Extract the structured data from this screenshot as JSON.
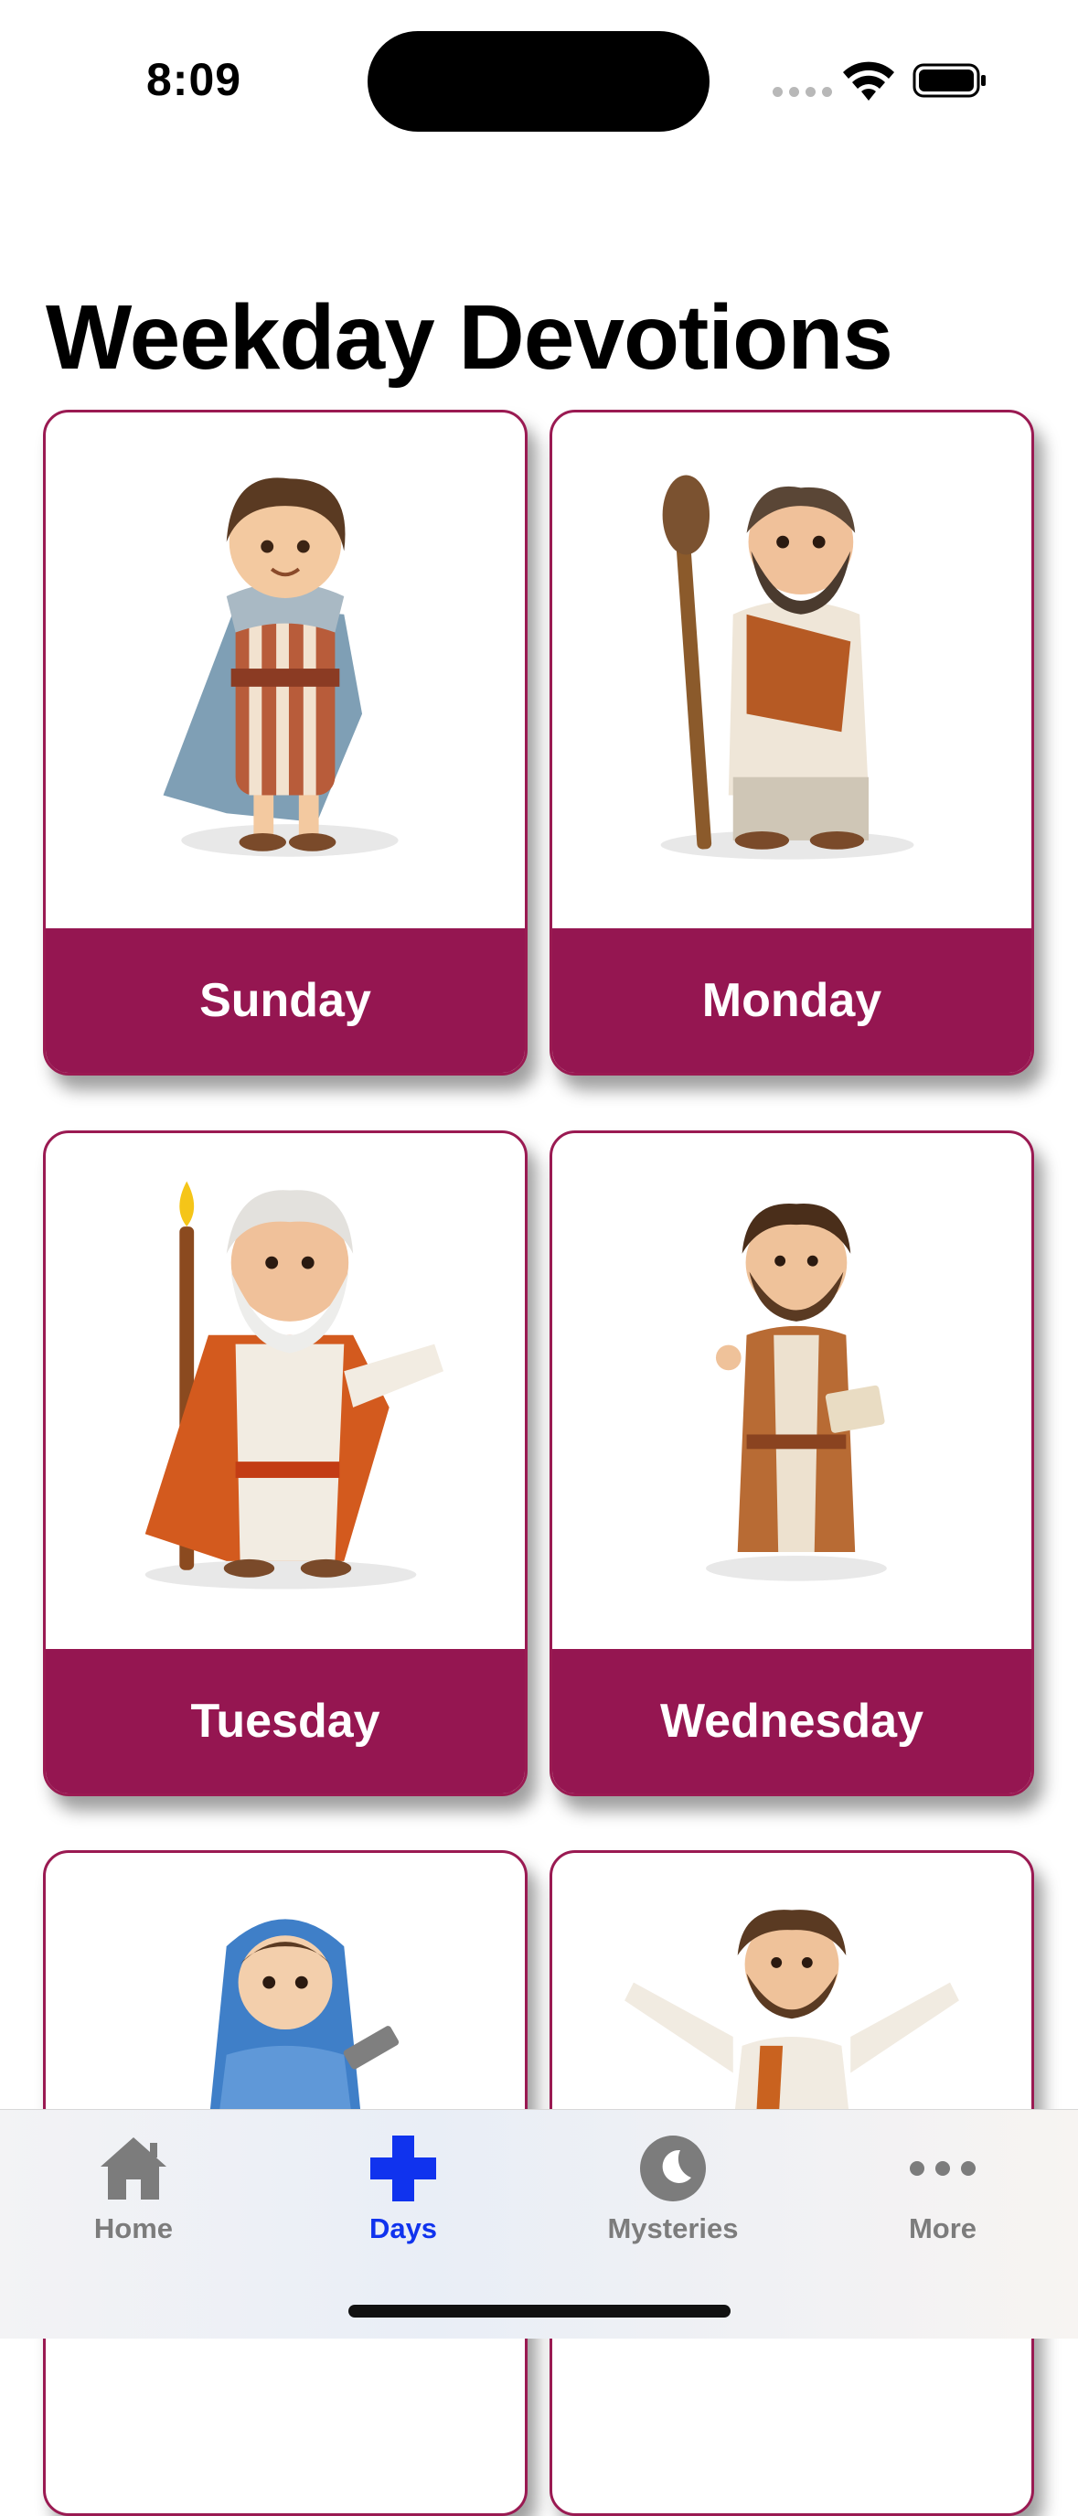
{
  "status_bar": {
    "time": "8:09"
  },
  "page": {
    "title": "Weekday Devotions"
  },
  "cards": [
    {
      "label": "Sunday",
      "icon": "young-boy-robe-illustration"
    },
    {
      "label": "Monday",
      "icon": "bearded-man-staff-illustration"
    },
    {
      "label": "Tuesday",
      "icon": "elder-moses-staff-illustration"
    },
    {
      "label": "Wednesday",
      "icon": "man-holding-book-illustration"
    },
    {
      "label": "",
      "icon": "woman-blue-veil-illustration"
    },
    {
      "label": "",
      "icon": "man-open-arms-illustration"
    }
  ],
  "tab_bar": {
    "tabs": [
      {
        "label": "Home",
        "icon": "home-icon"
      },
      {
        "label": "Days",
        "icon": "plus-icon",
        "active": true
      },
      {
        "label": "Mysteries",
        "icon": "moon-icon"
      },
      {
        "label": "More",
        "icon": "more-icon"
      }
    ]
  },
  "colors": {
    "accent": "#951651",
    "active_tab": "#1033ee",
    "inactive_tab": "#7c7c7c"
  }
}
